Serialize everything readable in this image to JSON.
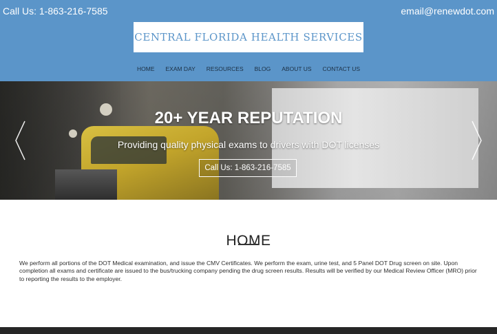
{
  "header": {
    "phone": "Call Us: 1-863-216-7585",
    "email": "email@renewdot.com",
    "logo_text": "CENTRAL FLORIDA HEALTH SERVICES",
    "background_color": "#5b95c9"
  },
  "nav": {
    "items": [
      "HOME",
      "EXAM DAY",
      "RESOURCES",
      "BLOG",
      "ABOUT US",
      "CONTACT US"
    ]
  },
  "hero": {
    "title": "20+ YEAR REPUTATION",
    "subtitle": "Providing quality physical exams to drivers with DOT licenses",
    "button_label": "Call Us: 1-863-216-7585",
    "prev_icon": "chevron-left-icon",
    "next_icon": "chevron-right-icon"
  },
  "main": {
    "heading": "HOME",
    "paragraph": "We perform all portions of the DOT Medical examination, and issue the CMV Certificates. We perform the exam, urine test, and 5 Panel DOT Drug screen on site. Upon completion all exams and certificate are issued to the bus/trucking company pending the drug screen results. Results will be verified by our Medical Review Officer (MRO) prior to reporting the results to the employer."
  }
}
